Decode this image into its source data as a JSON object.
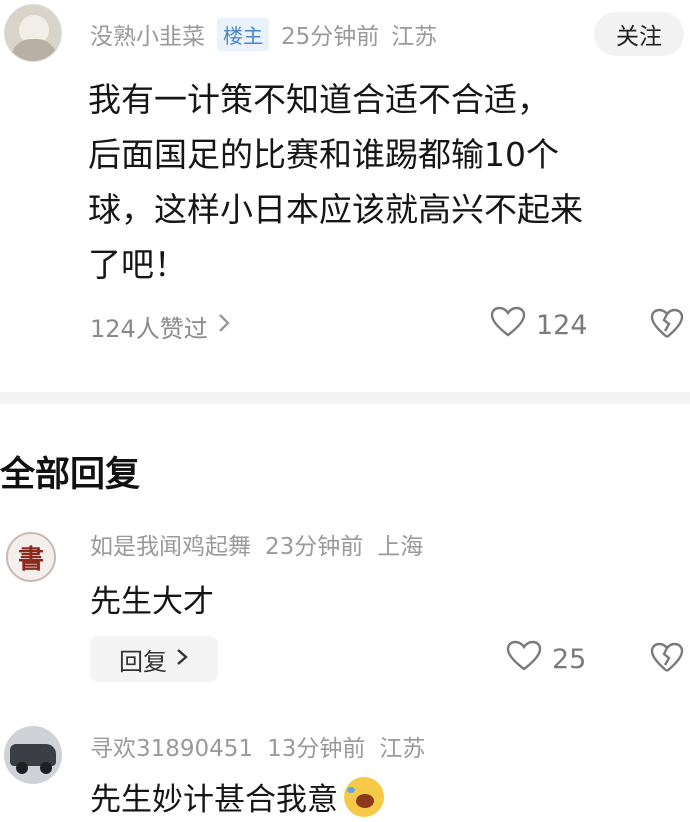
{
  "post": {
    "username": "没熟小韭菜",
    "badge": "楼主",
    "time": "25分钟前",
    "location": "江苏",
    "follow_label": "关注",
    "body_lines": [
      "我有一计策不知道合适不合适，",
      "后面国足的比赛和谁踢都输10个",
      "球，这样小日本应该就高兴不起来",
      "了吧！"
    ],
    "likes_summary": "124人赞过",
    "like_count": "124"
  },
  "replies_section": {
    "title": "全部回复"
  },
  "replies": [
    {
      "username": "如是我闻鸡起舞",
      "time": "23分钟前",
      "location": "上海",
      "text": "先生大才",
      "reply_label": "回复",
      "like_count": "25"
    },
    {
      "username": "寻欢31890451",
      "time": "13分钟前",
      "location": "江苏",
      "text": "先生妙计甚合我意"
    }
  ],
  "icons": {
    "chevron": "chevron-right-icon",
    "heart": "heart-outline-icon",
    "dislike": "broken-heart-icon",
    "emoji": "laughing-tears-emoji"
  },
  "colors": {
    "badge": "#4a86c8",
    "meta": "#9a9a9a"
  }
}
